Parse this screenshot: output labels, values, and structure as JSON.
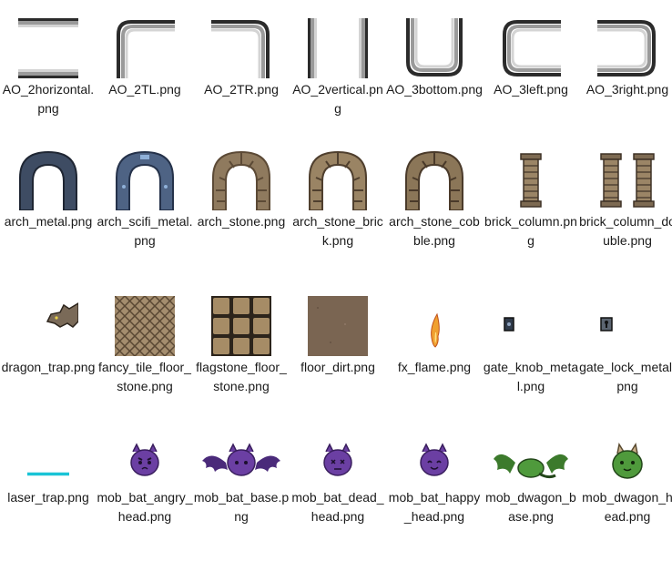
{
  "window": {
    "view": "Large icons"
  },
  "files": [
    {
      "name": "AO_2horizontal.png",
      "icon": "ao-2horizontal-icon"
    },
    {
      "name": "AO_2TL.png",
      "icon": "ao-2tl-icon"
    },
    {
      "name": "AO_2TR.png",
      "icon": "ao-2tr-icon"
    },
    {
      "name": "AO_2vertical.png",
      "icon": "ao-2vertical-icon"
    },
    {
      "name": "AO_3bottom.png",
      "icon": "ao-3bottom-icon"
    },
    {
      "name": "AO_3left.png",
      "icon": "ao-3left-icon"
    },
    {
      "name": "AO_3right.png",
      "icon": "ao-3right-icon"
    },
    {
      "name": "arch_metal.png",
      "icon": "arch-metal-icon"
    },
    {
      "name": "arch_scifi_metal.png",
      "icon": "arch-scifi-metal-icon"
    },
    {
      "name": "arch_stone.png",
      "icon": "arch-stone-icon"
    },
    {
      "name": "arch_stone_brick.png",
      "icon": "arch-stone-brick-icon"
    },
    {
      "name": "arch_stone_cobble.png",
      "icon": "arch-stone-cobble-icon"
    },
    {
      "name": "brick_column.png",
      "icon": "brick-column-icon"
    },
    {
      "name": "brick_column_double.png",
      "icon": "brick-column-double-icon"
    },
    {
      "name": "dragon_trap.png",
      "icon": "dragon-trap-icon"
    },
    {
      "name": "fancy_tile_floor_stone.png",
      "icon": "fancy-tile-floor-icon"
    },
    {
      "name": "flagstone_floor_stone.png",
      "icon": "flagstone-floor-icon"
    },
    {
      "name": "floor_dirt.png",
      "icon": "floor-dirt-icon"
    },
    {
      "name": "fx_flame.png",
      "icon": "flame-icon"
    },
    {
      "name": "gate_knob_metal.png",
      "icon": "gate-knob-icon"
    },
    {
      "name": "gate_lock_metal.png",
      "icon": "gate-lock-icon"
    },
    {
      "name": "laser_trap.png",
      "icon": "laser-trap-icon"
    },
    {
      "name": "mob_bat_angry_head.png",
      "icon": "bat-angry-head-icon"
    },
    {
      "name": "mob_bat_base.png",
      "icon": "bat-base-icon"
    },
    {
      "name": "mob_bat_dead_head.png",
      "icon": "bat-dead-head-icon"
    },
    {
      "name": "mob_bat_happy_head.png",
      "icon": "bat-happy-head-icon"
    },
    {
      "name": "mob_dwagon_base.png",
      "icon": "dwagon-base-icon"
    },
    {
      "name": "mob_dwagon_head.png",
      "icon": "dwagon-head-icon"
    }
  ],
  "colors": {
    "label_text": "#1a1a1a",
    "stone": "#8f7a5e",
    "stone_dark": "#5c4a36",
    "metal": "#3e4c63",
    "scifi": "#4e6384",
    "dirt": "#7a6552",
    "laser": "#19c4d6",
    "bat": "#6b3fa3",
    "dwagon": "#4f9a3c"
  }
}
